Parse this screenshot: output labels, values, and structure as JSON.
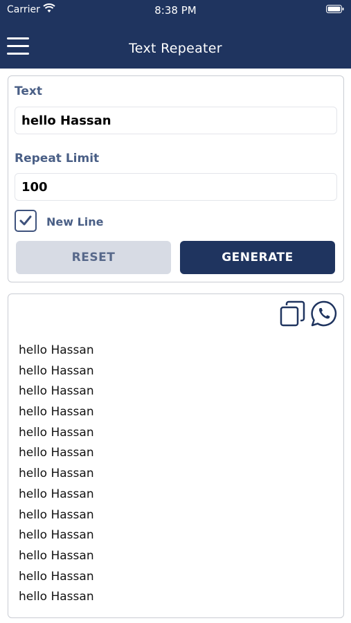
{
  "status": {
    "carrier": "Carrier",
    "time": "8:38 PM"
  },
  "nav": {
    "title": "Text Repeater"
  },
  "form": {
    "text_label": "Text",
    "text_value": "hello Hassan",
    "repeat_label": "Repeat Limit",
    "repeat_value": "100",
    "newline_label": "New Line",
    "newline_checked": true,
    "reset_label": "RESET",
    "generate_label": "GENERATE"
  },
  "output": {
    "lines": [
      "hello Hassan",
      "hello Hassan",
      "hello Hassan",
      "hello Hassan",
      "hello Hassan",
      "hello Hassan",
      "hello Hassan",
      "hello Hassan",
      "hello Hassan",
      "hello Hassan",
      "hello Hassan",
      "hello Hassan",
      "hello Hassan"
    ]
  },
  "colors": {
    "primary": "#1f345f",
    "label": "#4a5f86",
    "reset_bg": "#d7dbe4"
  },
  "icons": {
    "menu": "hamburger-icon",
    "copy": "copy-icon",
    "share": "whatsapp-icon",
    "check": "checkmark-icon"
  }
}
